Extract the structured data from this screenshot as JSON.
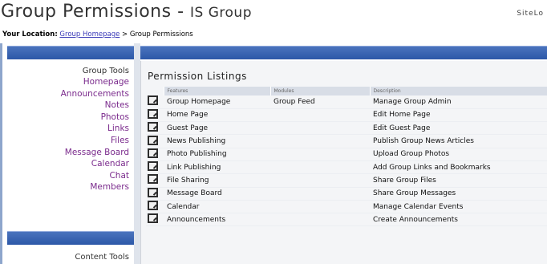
{
  "header": {
    "title": "Group Permissions - ",
    "group_name": "IS Group",
    "user_link": "SiteLo"
  },
  "breadcrumb": {
    "label": "Your Location:",
    "link": "Group Homepage",
    "current": " > Group Permissions"
  },
  "sidebar": {
    "group_tools_heading": "Group Tools",
    "items": [
      {
        "label": "Homepage"
      },
      {
        "label": "Announcements"
      },
      {
        "label": "Notes"
      },
      {
        "label": "Photos"
      },
      {
        "label": "Links"
      },
      {
        "label": "Files"
      },
      {
        "label": "Message Board"
      },
      {
        "label": "Calendar"
      },
      {
        "label": "Chat"
      },
      {
        "label": "Members"
      }
    ],
    "content_tools_heading": "Content Tools"
  },
  "main": {
    "panel_title": "Permission Listings",
    "columns": [
      "Features",
      "Modules",
      "Description"
    ],
    "rows": [
      {
        "feature": "Group Homepage",
        "module": "Group Feed",
        "description": "Manage Group Admin"
      },
      {
        "feature": "Home Page",
        "module": "",
        "description": "Edit Home Page"
      },
      {
        "feature": "Guest Page",
        "module": "",
        "description": "Edit Guest Page"
      },
      {
        "feature": "News Publishing",
        "module": "",
        "description": "Publish Group News Articles"
      },
      {
        "feature": "Photo Publishing",
        "module": "",
        "description": "Upload Group Photos"
      },
      {
        "feature": "Link Publishing",
        "module": "",
        "description": "Add Group Links and Bookmarks"
      },
      {
        "feature": "File Sharing",
        "module": "",
        "description": "Share Group Files"
      },
      {
        "feature": "Message Board",
        "module": "",
        "description": "Share Group Messages"
      },
      {
        "feature": "Calendar",
        "module": "",
        "description": "Manage Calendar Events"
      },
      {
        "feature": "Announcements",
        "module": "",
        "description": "Create Announcements"
      }
    ]
  },
  "colors": {
    "nav_bar": "#3a65b3",
    "side_link": "#7a2a8c",
    "panel_bg": "#f4f5f7"
  }
}
